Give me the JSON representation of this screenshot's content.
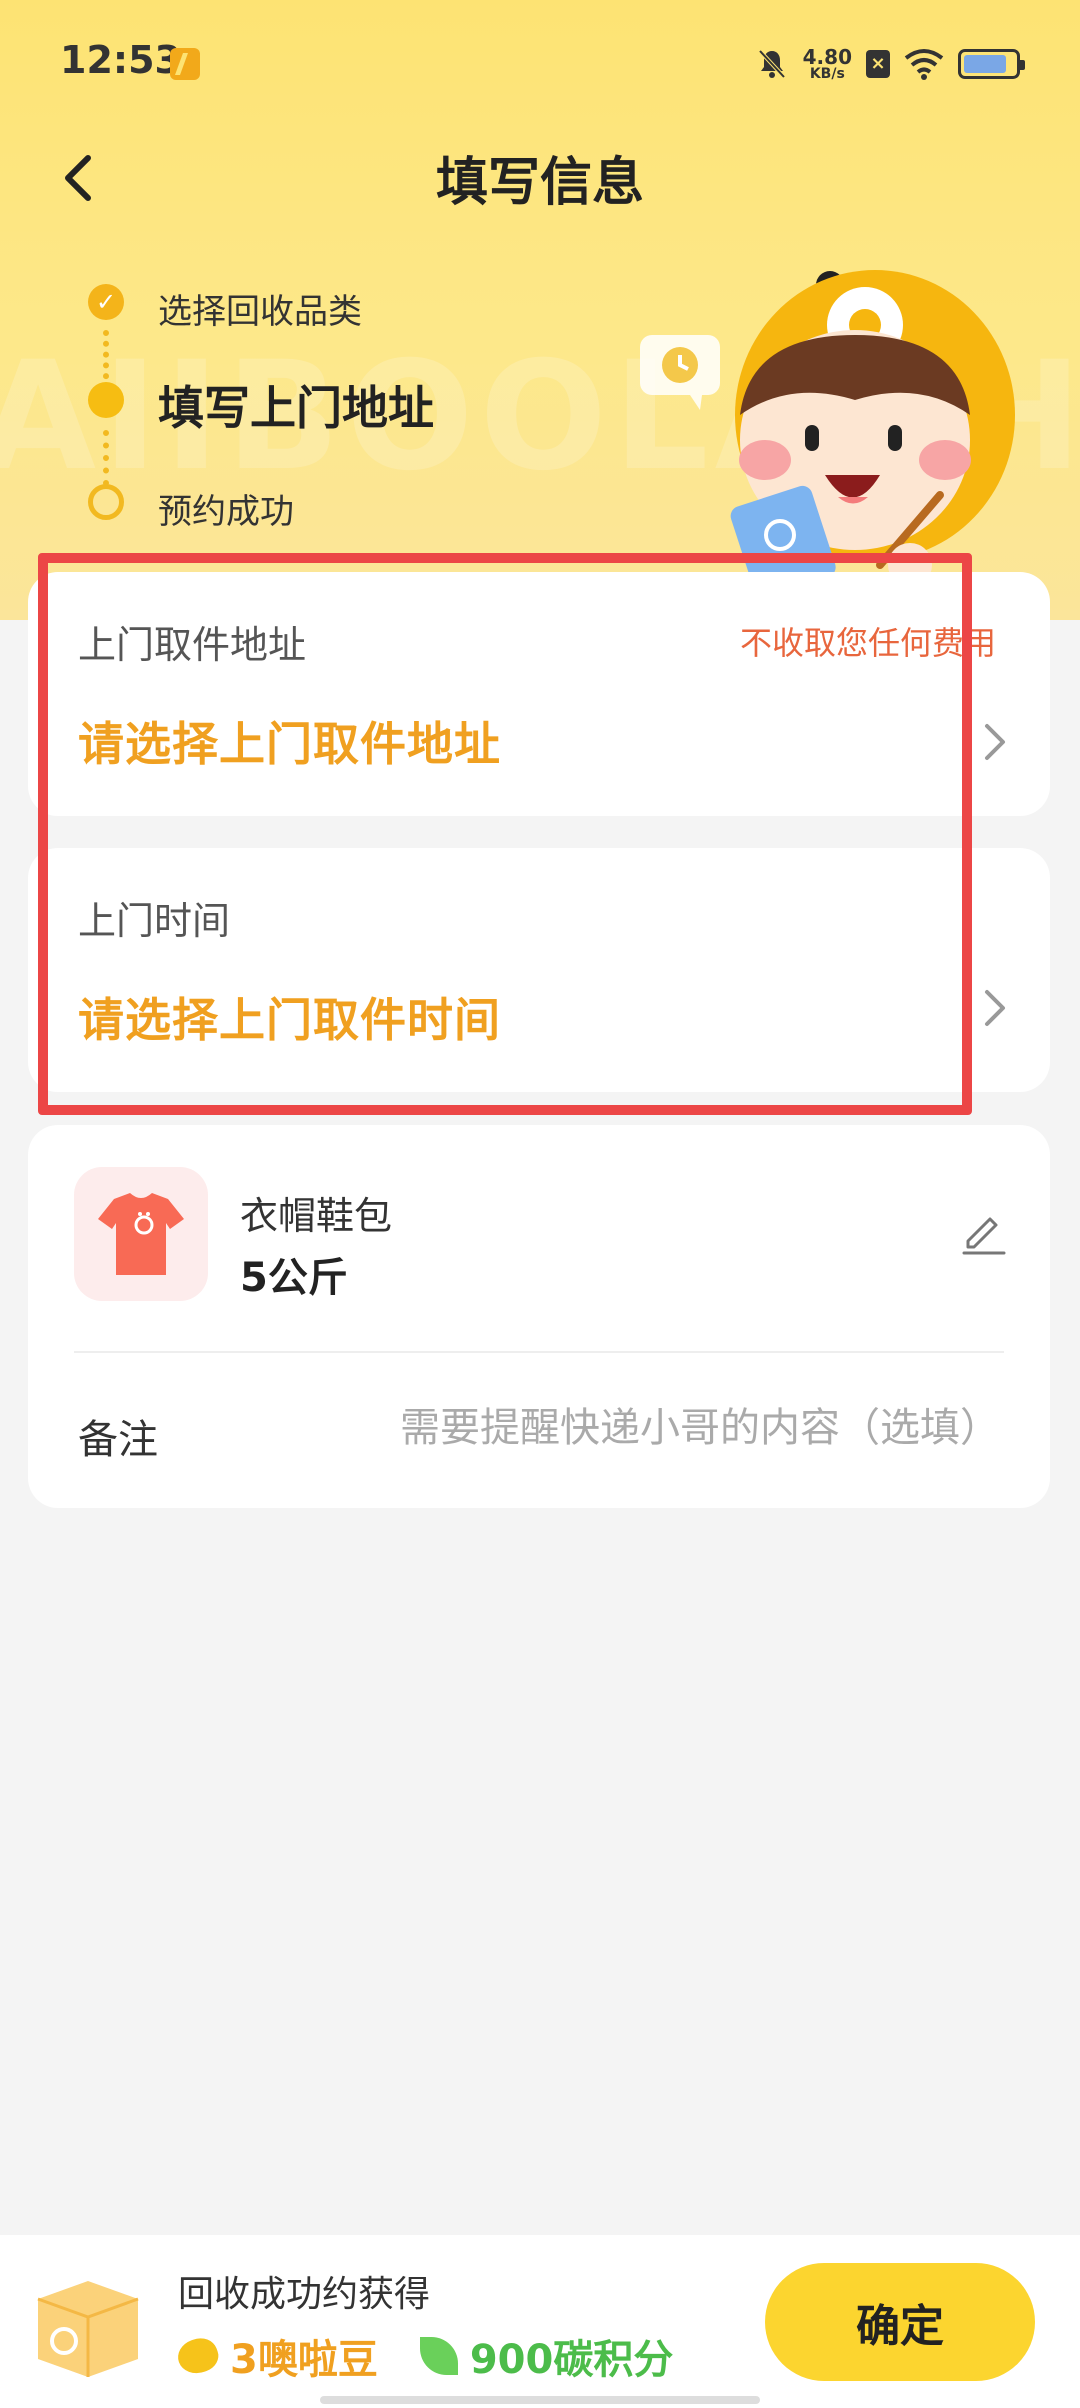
{
  "status_bar": {
    "time": "12:53",
    "net_speed_value": "4.80",
    "net_speed_unit": "KB/s",
    "sim_badge": "×"
  },
  "nav": {
    "title": "填写信息"
  },
  "steps": [
    {
      "label": "选择回收品类",
      "state": "done"
    },
    {
      "label": "填写上门地址",
      "state": "active"
    },
    {
      "label": "预约成功",
      "state": "pending"
    }
  ],
  "address_card": {
    "label": "上门取件地址",
    "hint": "不收取您任何费用",
    "placeholder": "请选择上门取件地址"
  },
  "time_card": {
    "label": "上门时间",
    "placeholder": "请选择上门取件时间"
  },
  "item_card": {
    "category": "衣帽鞋包",
    "weight": "5公斤",
    "note_label": "备注",
    "note_placeholder": "需要提醒快递小哥的内容（选填）"
  },
  "bottom_bar": {
    "reward_title": "回收成功约获得",
    "bean_reward": "3噢啦豆",
    "carbon_reward": "900碳积分",
    "confirm_label": "确定"
  },
  "colors": {
    "brand_yellow": "#fcd52f",
    "accent_orange": "#f0a020",
    "hint_red": "#e8663d",
    "highlight_border": "#ec4646",
    "carbon_green": "#4cbc4a"
  }
}
